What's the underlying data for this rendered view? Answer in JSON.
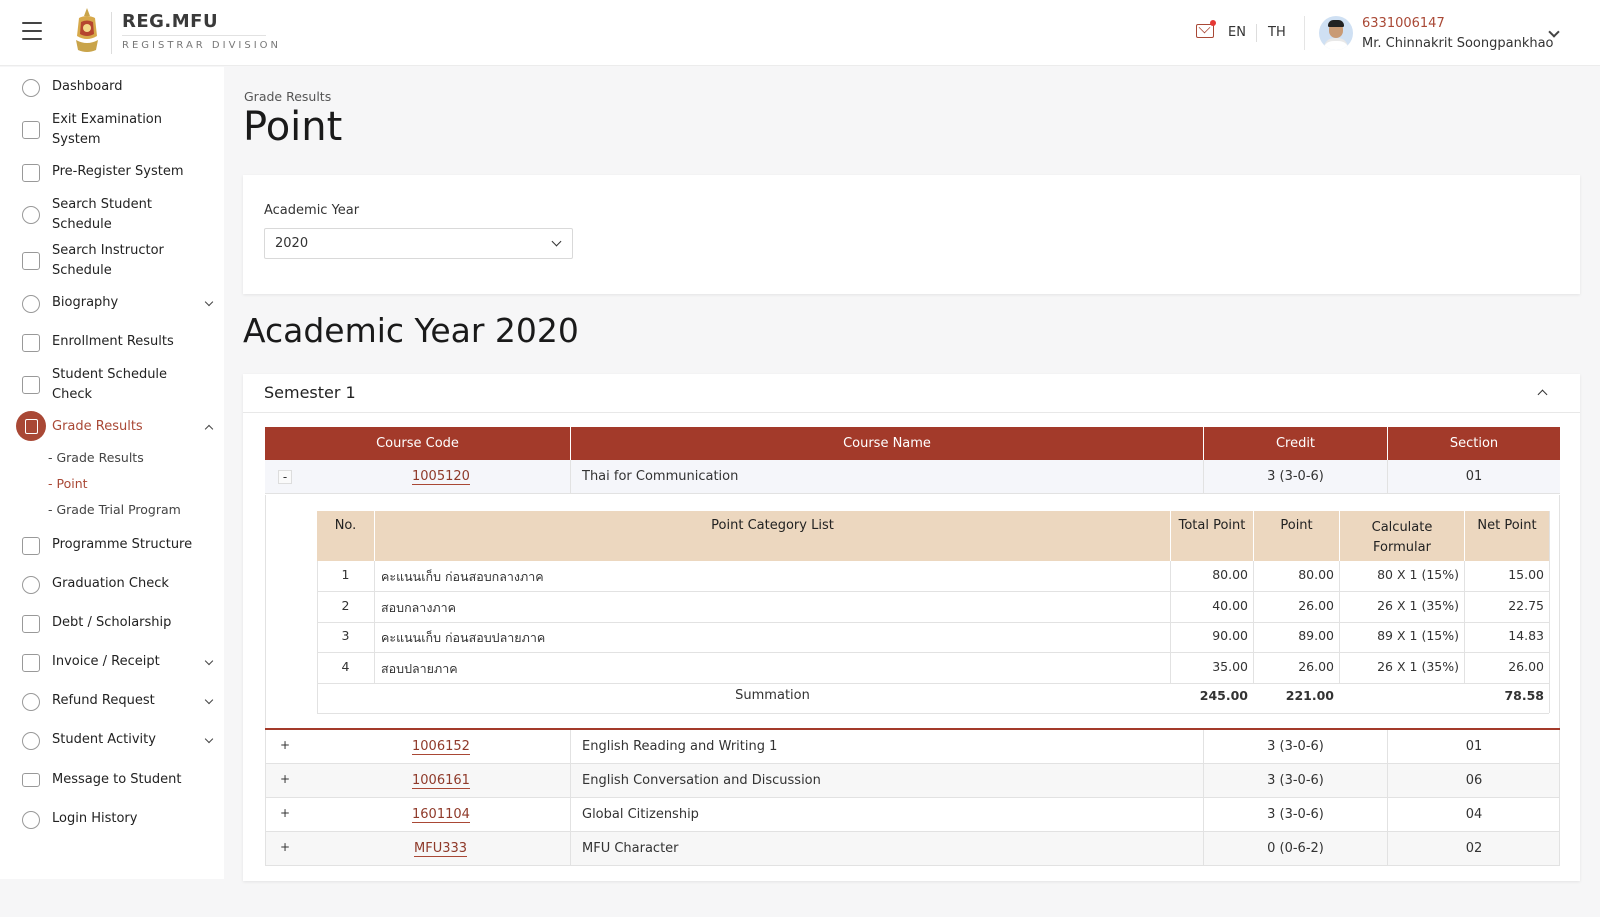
{
  "header": {
    "brand_title": "REG.MFU",
    "brand_subtitle": "REGISTRAR DIVISION",
    "lang_en": "EN",
    "lang_th": "TH",
    "user_id": "6331006147",
    "user_name": "Mr. Chinnakrit Soongpankhao"
  },
  "sidebar": {
    "items": [
      {
        "label": "Dashboard",
        "icon": "dashboard-icon"
      },
      {
        "label": "Exit Examination System",
        "icon": "exam-icon"
      },
      {
        "label": "Pre-Register System",
        "icon": "clipboard-icon"
      },
      {
        "label": "Search Student Schedule",
        "icon": "search-schedule-icon"
      },
      {
        "label": "Search Instructor Schedule",
        "icon": "instructor-icon"
      },
      {
        "label": "Biography",
        "icon": "people-icon"
      },
      {
        "label": "Enrollment Results",
        "icon": "document-icon"
      },
      {
        "label": "Student Schedule Check",
        "icon": "calendar-icon"
      },
      {
        "label": "Grade Results",
        "icon": "grade-icon"
      },
      {
        "label": "Programme Structure",
        "icon": "list-icon"
      },
      {
        "label": "Graduation Check",
        "icon": "graduation-icon"
      },
      {
        "label": "Debt / Scholarship",
        "icon": "money-icon"
      },
      {
        "label": "Invoice / Receipt",
        "icon": "invoice-icon"
      },
      {
        "label": "Refund Request",
        "icon": "refund-icon"
      },
      {
        "label": "Student Activity",
        "icon": "activity-icon"
      },
      {
        "label": "Message to Student",
        "icon": "mail-icon"
      },
      {
        "label": "Login History",
        "icon": "history-icon"
      }
    ],
    "sub_items": [
      "Grade Results",
      "Point",
      "Grade Trial Program"
    ]
  },
  "main": {
    "breadcrumb": "Grade Results",
    "title": "Point",
    "filter_label": "Academic Year",
    "selected_year": "2020",
    "year_heading": "Academic Year 2020",
    "semester_title": "Semester 1"
  },
  "course_table": {
    "headers": [
      "Course Code",
      "Course Name",
      "Credit",
      "Section"
    ],
    "expanded": {
      "toggle": "-",
      "code": "1005120",
      "name": "Thai for Communication",
      "credit": "3 (3-0-6)",
      "section": "01"
    },
    "rows": [
      {
        "toggle": "+",
        "code": "1006152",
        "name": "English Reading and Writing 1",
        "credit": "3 (3-0-6)",
        "section": "01"
      },
      {
        "toggle": "+",
        "code": "1006161",
        "name": "English Conversation and Discussion",
        "credit": "3 (3-0-6)",
        "section": "06"
      },
      {
        "toggle": "+",
        "code": "1601104",
        "name": "Global Citizenship",
        "credit": "3 (3-0-6)",
        "section": "04"
      },
      {
        "toggle": "+",
        "code": "MFU333",
        "name": "MFU Character",
        "credit": "0 (0-6-2)",
        "section": "02"
      }
    ]
  },
  "point_table": {
    "headers": {
      "no": "No.",
      "category": "Point Category List",
      "total": "Total Point",
      "point": "Point",
      "formula_1": "Calculate",
      "formula_2": "Formular",
      "net": "Net Point"
    },
    "rows": [
      {
        "no": "1",
        "category": "คะแนนเก็บ ก่อนสอบกลางภาค",
        "total": "80.00",
        "point": "80.00",
        "formula": "80 X 1 (15%)",
        "net": "15.00"
      },
      {
        "no": "2",
        "category": "สอบกลางภาค",
        "total": "40.00",
        "point": "26.00",
        "formula": "26 X 1 (35%)",
        "net": "22.75"
      },
      {
        "no": "3",
        "category": "คะแนนเก็บ ก่อนสอบปลายภาค",
        "total": "90.00",
        "point": "89.00",
        "formula": "89 X 1 (15%)",
        "net": "14.83"
      },
      {
        "no": "4",
        "category": "สอบปลายภาค",
        "total": "35.00",
        "point": "26.00",
        "formula": "26 X 1 (35%)",
        "net": "26.00"
      }
    ],
    "summation": {
      "label": "Summation",
      "total": "245.00",
      "point": "221.00",
      "net": "78.58"
    }
  },
  "colors": {
    "accent": "#a33a2a",
    "brand_text": "#a94835",
    "point_header_bg": "#ecd7bf"
  }
}
